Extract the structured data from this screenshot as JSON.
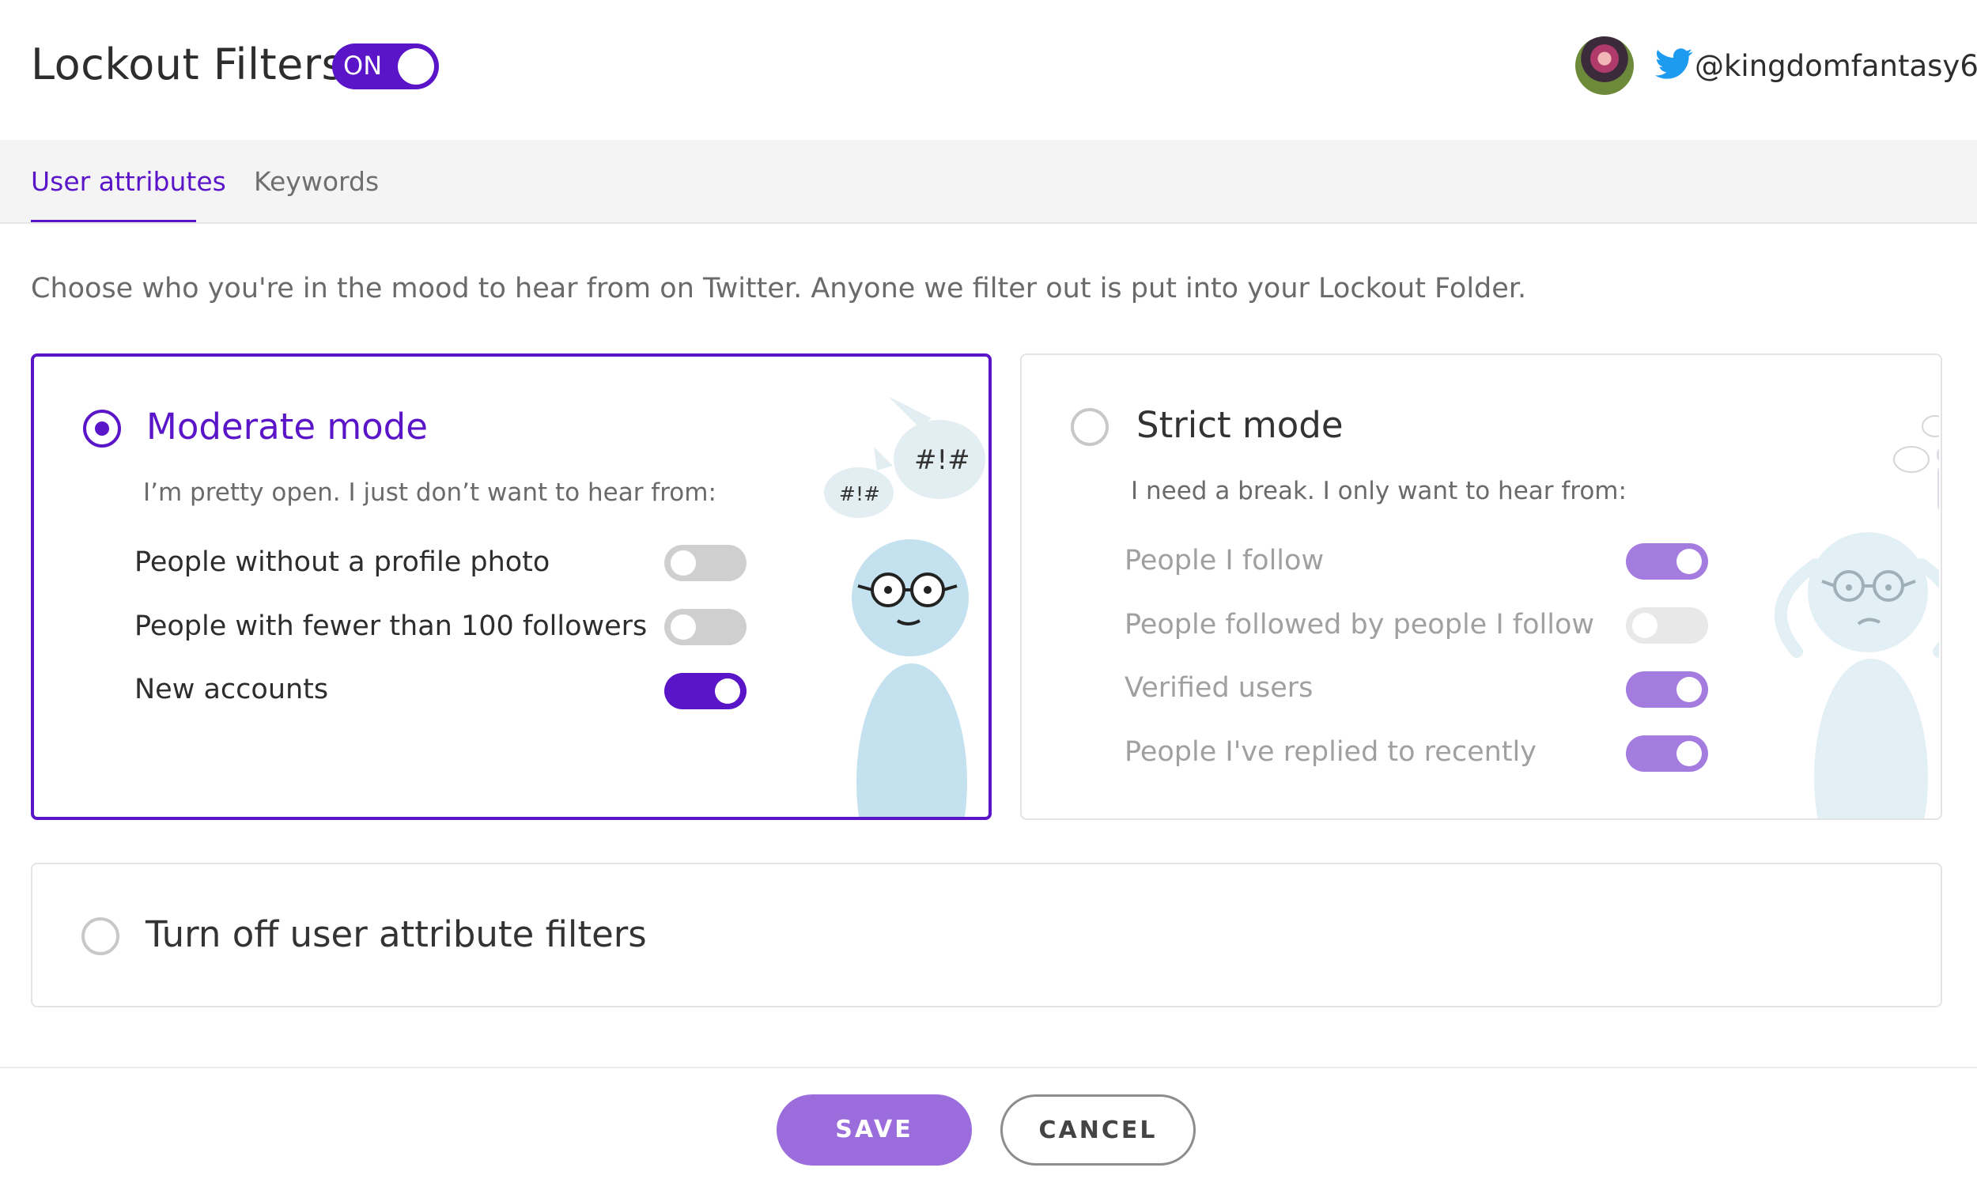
{
  "header": {
    "title": "Lockout Filters",
    "master_toggle": {
      "label": "ON",
      "state": true
    },
    "account": {
      "handle": "@kingdomfantasy6",
      "icon": "twitter-bird-icon"
    }
  },
  "tabs": [
    {
      "label": "User attributes",
      "active": true
    },
    {
      "label": "Keywords",
      "active": false
    }
  ],
  "intro": "Choose who you're in the mood to hear from on Twitter. Anyone we filter out is put into your Lockout Folder.",
  "moderate": {
    "title": "Moderate mode",
    "selected": true,
    "subtitle": "I’m pretty open. I just don’t want to hear from:",
    "bubble_large": "#!#",
    "bubble_small": "#!#",
    "options": [
      {
        "label": "People without a profile photo",
        "on": false
      },
      {
        "label": "People with fewer than 100 followers",
        "on": false
      },
      {
        "label": "New accounts",
        "on": true
      }
    ]
  },
  "strict": {
    "title": "Strict mode",
    "selected": false,
    "subtitle": "I need a break. I only want to hear from:",
    "options": [
      {
        "label": "People I follow",
        "on": true
      },
      {
        "label": "People followed by people I follow",
        "on": false
      },
      {
        "label": "Verified users",
        "on": true
      },
      {
        "label": "People I've replied to recently",
        "on": true
      }
    ]
  },
  "off": {
    "title": "Turn off user attribute filters",
    "selected": false
  },
  "footer": {
    "save_label": "SAVE",
    "cancel_label": "CANCEL"
  },
  "colors": {
    "accent": "#5b15c9",
    "accent_muted": "#9b6ddc",
    "figure": "#c3e1ee"
  }
}
